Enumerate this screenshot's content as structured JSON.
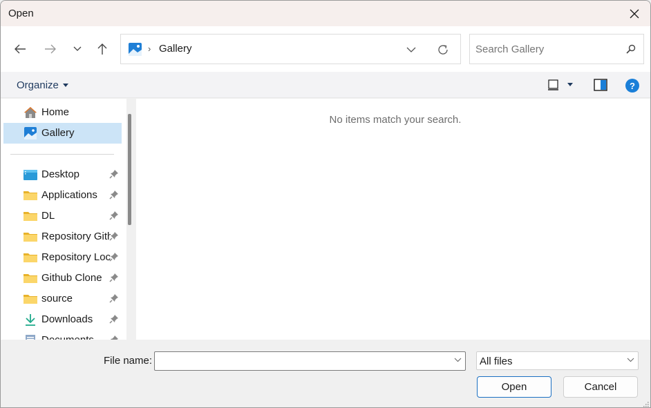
{
  "window": {
    "title": "Open"
  },
  "navigation": {
    "back_label": "Back",
    "forward_label": "Forward",
    "recent_label": "Recent locations",
    "up_label": "Up"
  },
  "address_bar": {
    "location_icon": "gallery-icon",
    "separator": "›",
    "breadcrumb": "Gallery"
  },
  "search": {
    "placeholder": "Search Gallery",
    "value": ""
  },
  "command_bar": {
    "organize_label": "Organize",
    "view_icon": "view-icon",
    "preview_icon": "preview-pane-icon",
    "help_label": "?"
  },
  "sidebar": {
    "top_items": [
      {
        "label": "Home",
        "icon": "home-icon"
      },
      {
        "label": "Gallery",
        "icon": "gallery-icon",
        "selected": true
      }
    ],
    "pinned_items": [
      {
        "label": "Desktop",
        "icon": "desktop-icon"
      },
      {
        "label": "Applications",
        "icon": "folder-icon"
      },
      {
        "label": "DL",
        "icon": "folder-icon"
      },
      {
        "label": "Repository Github",
        "icon": "folder-icon"
      },
      {
        "label": "Repository Local",
        "icon": "folder-icon"
      },
      {
        "label": "Github Clone",
        "icon": "folder-icon"
      },
      {
        "label": "source",
        "icon": "folder-icon"
      },
      {
        "label": "Downloads",
        "icon": "download-icon"
      },
      {
        "label": "Documents",
        "icon": "documents-icon"
      }
    ]
  },
  "content": {
    "empty_message": "No items match your search."
  },
  "footer": {
    "file_name_label": "File name:",
    "file_name_value": "",
    "file_type_selected": "All files",
    "open_label": "Open",
    "cancel_label": "Cancel"
  },
  "colors": {
    "accent": "#1a6fc2",
    "selection": "#cce4f7",
    "titlebar": "#f6efed",
    "folder": "#f7c948"
  }
}
